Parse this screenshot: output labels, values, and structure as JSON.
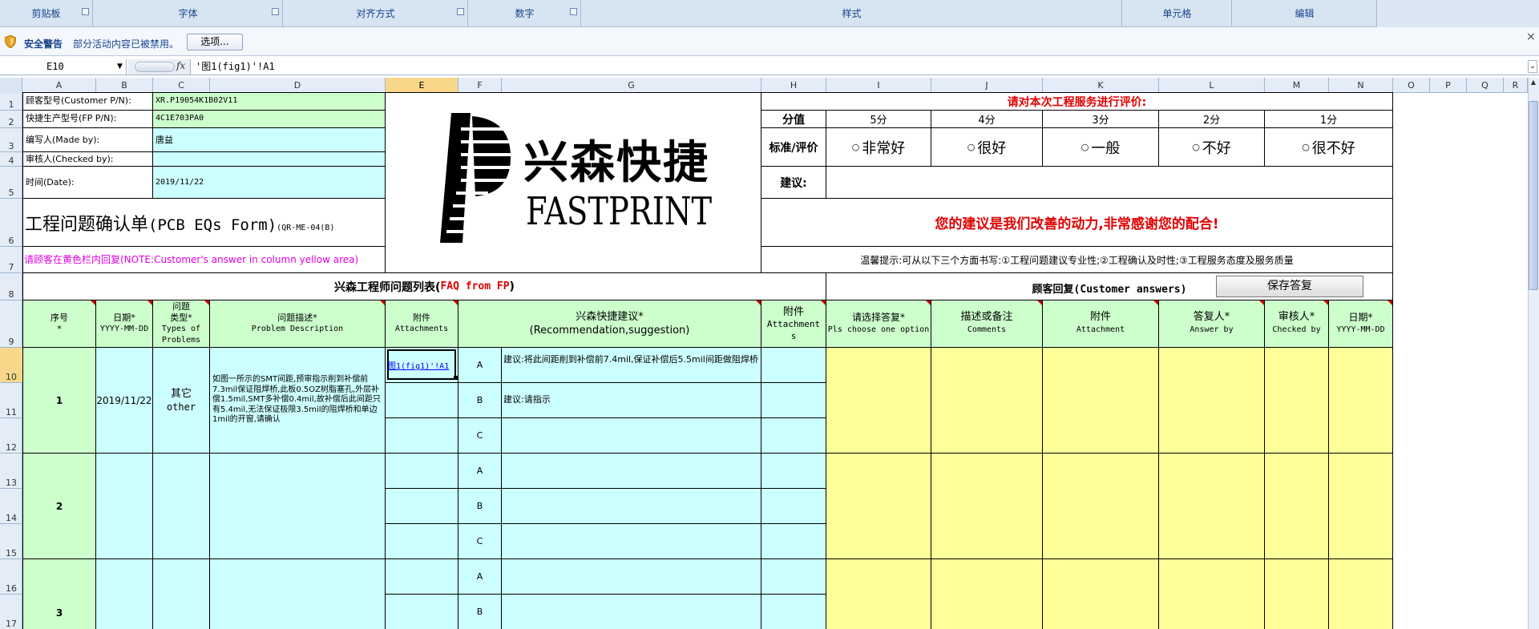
{
  "ribbon": {
    "groups": [
      "剪贴板",
      "字体",
      "对齐方式",
      "数字",
      "样式",
      "单元格",
      "编辑"
    ]
  },
  "security": {
    "title": "安全警告",
    "message": "部分活动内容已被禁用。",
    "options_label": "选项...",
    "close": "×"
  },
  "formula_bar": {
    "name_box": "E10",
    "fx": "fx",
    "formula": "'图1(fig1)'!A1"
  },
  "grid": {
    "columns": [
      "A",
      "B",
      "C",
      "D",
      "E",
      "F",
      "G",
      "H",
      "I",
      "J",
      "K",
      "L",
      "M",
      "N",
      "O",
      "P",
      "Q",
      "R"
    ],
    "rows": [
      "1",
      "2",
      "3",
      "4",
      "5",
      "6",
      "7",
      "8",
      "9",
      "10",
      "11",
      "12",
      "13",
      "14",
      "15",
      "16",
      "17"
    ],
    "selected_column": "E",
    "selected_row": "10"
  },
  "sheet": {
    "customer_pn_label": "顾客型号(Customer P/N):",
    "customer_pn_value": "XR.P19054K1B02V11",
    "fp_pn_label": "快捷生产型号(FP P/N):",
    "fp_pn_value": "4C1E703PA0",
    "made_by_label": "编写人(Made by):",
    "made_by_value": "唐益",
    "checked_by_label": "审核人(Checked by):",
    "checked_by_value": "",
    "date_label": "时间(Date):",
    "date_value": "2019/11/22",
    "form_title": "工程问题确认单",
    "form_title_en": "(PCB EQs Form)",
    "form_code": "(QR-ME-04(B)",
    "yellow_note": "请顾客在黄色栏内回复(NOTE:Customer's answer in column yellow area)",
    "logo_cn": "兴森快捷",
    "logo_en": "FASTPRINT",
    "rating_title": "请对本次工程服务进行评价:",
    "score_label": "分值",
    "scores": [
      "5分",
      "4分",
      "3分",
      "2分",
      "1分"
    ],
    "criteria_label": "标准/评价",
    "ratings": [
      "非常好",
      "很好",
      "一般",
      "不好",
      "很不好"
    ],
    "suggestion_label": "建议:",
    "thanks": "您的建议是我们改善的动力,非常感谢您的配合!",
    "tip": "温馨提示:可从以下三个方面书写:①工程问题建议专业性;②工程确认及时性;③工程服务态度及服务质量",
    "faq_title_cn": "兴森工程师问题列表(",
    "faq_title_en": "FAQ from FP",
    "faq_title_close": ")",
    "customer_answers_title": "顾客回复(Customer answers)",
    "save_reply_label": "保存答复",
    "headers": {
      "seq_cn": "序号",
      "seq_en": "*",
      "date_cn": "日期*",
      "date_en": "YYYY-MM-DD",
      "type_cn": "问题",
      "type_cn2": "类型*",
      "type_en": "Types of",
      "type_en2": "Problems",
      "desc_cn": "问题描述*",
      "desc_en": "Problem Description",
      "attach_cn": "附件",
      "attach_en": "Attachments",
      "sugg_cn": "兴森快捷建议*",
      "sugg_en": "(Recommendation,suggestion)",
      "attach2_cn": "附件",
      "attach2_en": "Attachment",
      "attach2_en2": "s",
      "choose_cn": "请选择答复*",
      "choose_en": "Pls choose one option",
      "comments_cn": "描述或备注",
      "comments_en": "Comments",
      "attach3_cn": "附件",
      "attach3_en": "Attachment",
      "answer_cn": "答复人*",
      "answer_en": "Answer by",
      "check_cn": "审核人*",
      "check_en": "Checked by",
      "date2_cn": "日期*",
      "date2_en": "YYYY-MM-DD"
    },
    "items": [
      {
        "seq": "1",
        "date": "2019/11/22",
        "type_cn": "其它",
        "type_en": "other",
        "description": "如图一所示的SMT间距,预审指示削到补偿前7.3mil保证阻焊桥,此板0.5OZ树脂塞孔,外层补偿1.5mil,SMT多补偿0.4mil,故补偿后此间距只有5.4mil,无法保证极限3.5mil的阻焊桥和单边1mil的开窗,请确认",
        "attachment_link": "图1(fig1)'!A1",
        "options": [
          {
            "letter": "A",
            "text": "建议:将此间距削到补偿前7.4mil,保证补偿后5.5mil间距做阻焊桥"
          },
          {
            "letter": "B",
            "text": "建议:请指示"
          },
          {
            "letter": "C",
            "text": ""
          }
        ]
      },
      {
        "seq": "2",
        "options": [
          {
            "letter": "A",
            "text": ""
          },
          {
            "letter": "B",
            "text": ""
          },
          {
            "letter": "C",
            "text": ""
          }
        ]
      },
      {
        "seq": "3",
        "options": [
          {
            "letter": "A",
            "text": ""
          },
          {
            "letter": "B",
            "text": ""
          }
        ]
      }
    ]
  },
  "colors": {
    "green": "#ccffcc",
    "cyan": "#ccffff",
    "yellow": "#ffff99",
    "red": "#e00000",
    "ribbon_text": "#15428b"
  }
}
